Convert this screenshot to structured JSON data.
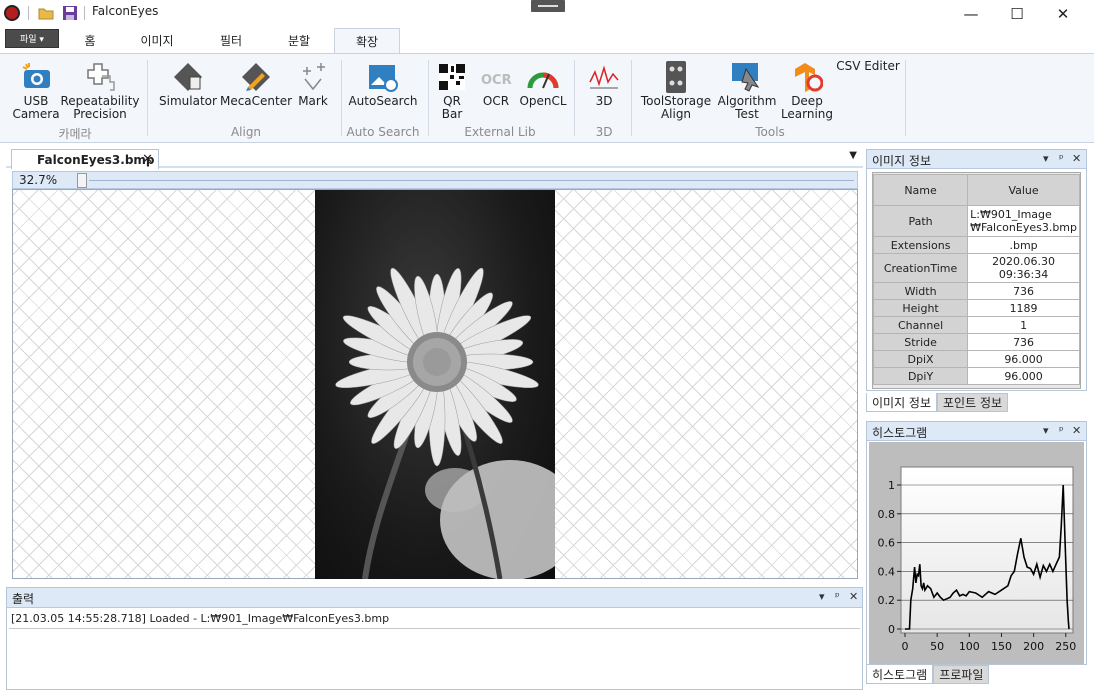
{
  "app": {
    "title": "FalconEyes"
  },
  "ribbon_tabs": {
    "file": "파일 ▾",
    "tabs": [
      "홈",
      "이미지",
      "필터",
      "분할",
      "확장"
    ],
    "active": "확장"
  },
  "ribbon": {
    "buttons": [
      {
        "line1": "USB",
        "line2": "Camera"
      },
      {
        "line1": "Repeatability",
        "line2": "Precision"
      },
      {
        "line1": "Simulator",
        "line2": ""
      },
      {
        "line1": "MecaCenter",
        "line2": ""
      },
      {
        "line1": "Mark",
        "line2": ""
      },
      {
        "line1": "AutoSearch",
        "line2": ""
      },
      {
        "line1": "QR",
        "line2": "Bar"
      },
      {
        "line1": "OCR",
        "line2": ""
      },
      {
        "line1": "OpenCL",
        "line2": ""
      },
      {
        "line1": "3D",
        "line2": ""
      },
      {
        "line1": "ToolStorage",
        "line2": "Align"
      },
      {
        "line1": "Algorithm",
        "line2": "Test"
      },
      {
        "line1": "Deep",
        "line2": "Learning"
      },
      {
        "line1": "CSV Editer",
        "line2": ""
      }
    ],
    "groups": [
      "카메라",
      "Align",
      "Auto Search",
      "External Lib",
      "3D",
      "Tools"
    ]
  },
  "document": {
    "tab": "FalconEyes3.bmp",
    "close": "✕",
    "zoom": "32.7%"
  },
  "output": {
    "title": "출력",
    "line": "[21.03.05 14:55:28.718] Loaded - L:₩901_Image₩FalconEyes3.bmp"
  },
  "image_info": {
    "title": "이미지 정보",
    "headers": [
      "Name",
      "Value"
    ],
    "rows": [
      {
        "name": "Path",
        "value": "L:₩901_Image ₩FalconEyes3.bmp"
      },
      {
        "name": "Extensions",
        "value": ".bmp"
      },
      {
        "name": "CreationTime",
        "value": "2020.06.30 09:36:34"
      },
      {
        "name": "Width",
        "value": "736"
      },
      {
        "name": "Height",
        "value": "1189"
      },
      {
        "name": "Channel",
        "value": "1"
      },
      {
        "name": "Stride",
        "value": "736"
      },
      {
        "name": "DpiX",
        "value": "96.000"
      },
      {
        "name": "DpiY",
        "value": "96.000"
      }
    ],
    "tabs": [
      "이미지 정보",
      "포인트 정보"
    ]
  },
  "histogram": {
    "title": "히스토그램",
    "tabs": [
      "히스토그램",
      "프로파일"
    ],
    "panel_controls": [
      "▾",
      "ᵖ",
      "✕"
    ]
  },
  "chart_data": {
    "type": "line",
    "title": "",
    "xlabel": "",
    "ylabel": "",
    "xlim": [
      0,
      255
    ],
    "ylim": [
      0,
      1
    ],
    "xticks": [
      0,
      50,
      100,
      150,
      200,
      250
    ],
    "yticks": [
      0,
      0.2,
      0.4,
      0.6,
      0.8,
      1
    ],
    "ytick_labels": [
      "0",
      "0.2",
      "0.4",
      "0.6",
      "0.8",
      "1"
    ],
    "grid": true,
    "x": [
      0,
      4,
      7,
      9,
      12,
      15,
      17,
      19,
      21,
      23,
      25,
      27,
      29,
      31,
      35,
      40,
      45,
      50,
      55,
      60,
      65,
      70,
      75,
      80,
      85,
      90,
      95,
      100,
      110,
      120,
      130,
      140,
      150,
      160,
      165,
      170,
      175,
      180,
      185,
      190,
      195,
      200,
      205,
      210,
      215,
      220,
      225,
      230,
      235,
      240,
      243,
      246,
      249,
      252,
      254,
      255
    ],
    "values": [
      0,
      0,
      0,
      0.2,
      0.28,
      0.43,
      0.32,
      0.38,
      0.37,
      0.45,
      0.3,
      0.28,
      0.32,
      0.27,
      0.3,
      0.28,
      0.22,
      0.25,
      0.22,
      0.2,
      0.21,
      0.22,
      0.25,
      0.27,
      0.23,
      0.24,
      0.23,
      0.26,
      0.25,
      0.22,
      0.26,
      0.24,
      0.27,
      0.3,
      0.37,
      0.4,
      0.52,
      0.63,
      0.5,
      0.43,
      0.42,
      0.38,
      0.45,
      0.36,
      0.44,
      0.4,
      0.45,
      0.4,
      0.45,
      0.5,
      0.72,
      1.0,
      0.6,
      0.2,
      0.05,
      0
    ]
  }
}
